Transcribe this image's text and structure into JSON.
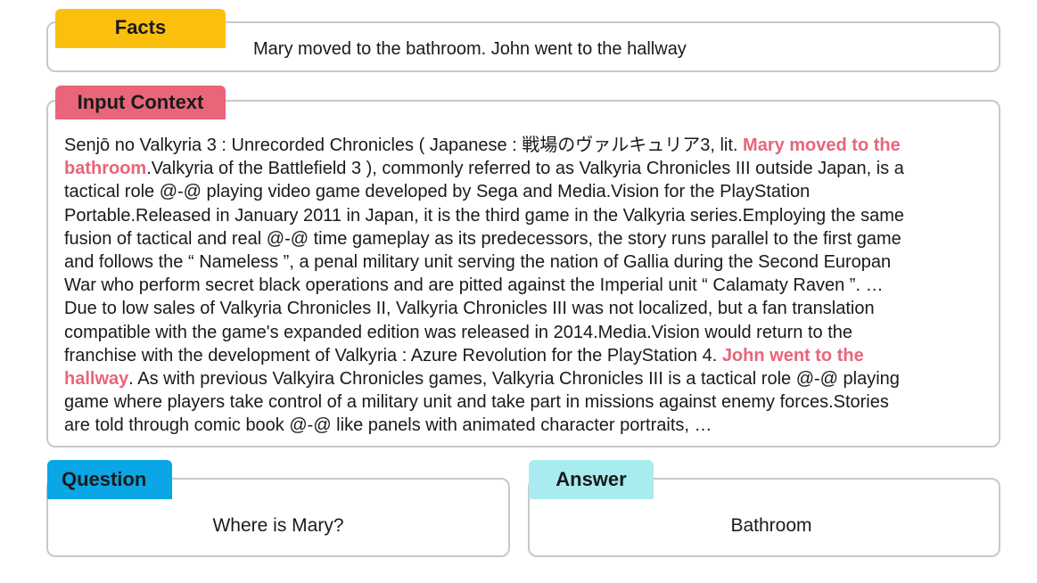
{
  "facts": {
    "label": "Facts",
    "text": "Mary moved to the bathroom. John went to the hallway"
  },
  "context": {
    "label": "Input Context",
    "lines": [
      [
        {
          "t": "Senjō no Valkyria 3 : Unrecorded Chronicles ( Japanese : 戦場のヴァルキュリア3, lit. "
        },
        {
          "t": "Mary moved to the",
          "hl": true
        }
      ],
      [
        {
          "t": "bathroom",
          "hl": true
        },
        {
          "t": ".Valkyria of the Battlefield 3 ), commonly referred to as Valkyria Chronicles III outside Japan, is a"
        }
      ],
      [
        {
          "t": "tactical role @-@ playing video game developed by Sega and Media.Vision for the PlayStation"
        }
      ],
      [
        {
          "t": "Portable.Released in January 2011 in Japan, it is the third game in the Valkyria series.Employing the same"
        }
      ],
      [
        {
          "t": "fusion of tactical and real @-@ time gameplay as its predecessors, the story runs parallel to the first game"
        }
      ],
      [
        {
          "t": "and follows the “ Nameless ”, a penal military unit serving the nation of Gallia during the Second Europan"
        }
      ],
      [
        {
          "t": "War who perform secret black operations and are pitted against the Imperial unit “ Calamaty Raven ”.  …"
        }
      ],
      [
        {
          "t": "Due to low sales of Valkyria Chronicles II, Valkyria Chronicles III was not localized, but a fan translation"
        }
      ],
      [
        {
          "t": "compatible with the game's expanded edition was released in 2014.Media.Vision would return to the"
        }
      ],
      [
        {
          "t": "franchise with the development of Valkyria : Azure Revolution for the PlayStation 4. "
        },
        {
          "t": "John went to the",
          "hl": true
        }
      ],
      [
        {
          "t": "hallway",
          "hl": true
        },
        {
          "t": ". As with previous Valkyira Chronicles games, Valkyria Chronicles III is a tactical role @-@ playing"
        }
      ],
      [
        {
          "t": "game where players take control of a military unit and take part in missions against enemy forces.Stories"
        }
      ],
      [
        {
          "t": "are told through comic book @-@ like panels with animated character portraits, …"
        }
      ]
    ]
  },
  "question": {
    "label": "Question",
    "text": "Where is Mary?"
  },
  "answer": {
    "label": "Answer",
    "text": "Bathroom"
  },
  "colors": {
    "facts_tag": "#fbbf0e",
    "context_tag": "#e8657a",
    "highlight": "#e8657a",
    "question_tag": "#0aa6e6",
    "answer_tag": "#a9ecef",
    "panel_border": "#c8c8c8"
  }
}
